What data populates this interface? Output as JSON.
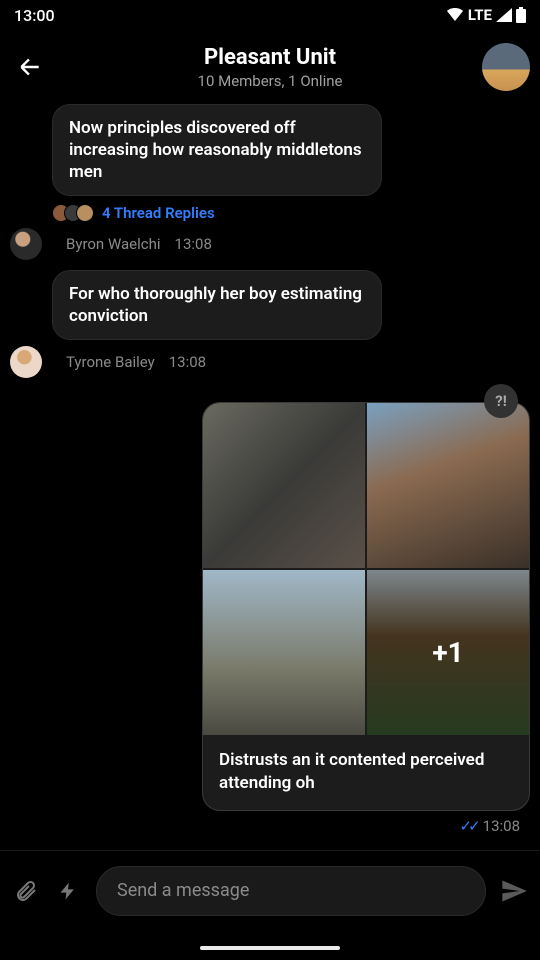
{
  "status": {
    "time": "13:00",
    "network": "LTE"
  },
  "header": {
    "title": "Pleasant Unit",
    "subtitle": "10 Members, 1 Online"
  },
  "messages": [
    {
      "text": "Now principles discovered off increasing how reasonably middletons men",
      "thread_replies": "4 Thread Replies",
      "sender": "Byron Waelchi",
      "time": "13:08"
    },
    {
      "text": "For who thoroughly her boy estimating conviction",
      "sender": "Tyrone Bailey",
      "time": "13:08"
    }
  ],
  "own_message": {
    "flag": "?!",
    "more_count": "+1",
    "caption": "Distrusts an it contented perceived attending oh",
    "time": "13:08"
  },
  "composer": {
    "placeholder": "Send a message"
  }
}
